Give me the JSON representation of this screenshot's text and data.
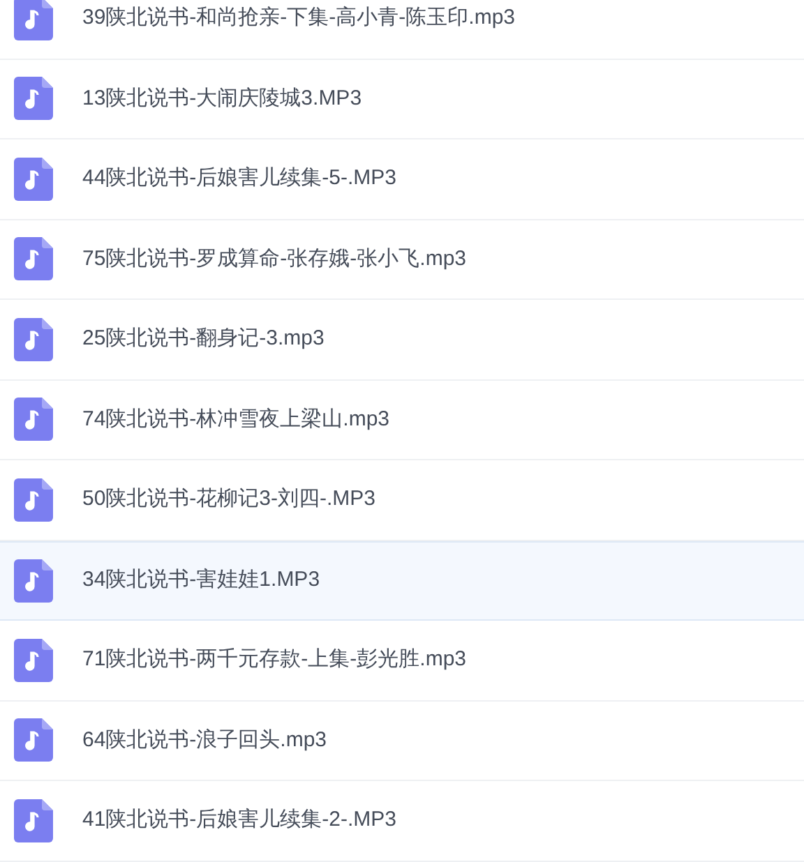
{
  "files": [
    {
      "name": "39陕北说书-和尚抢亲-下集-高小青-陈玉印.mp3",
      "selected": false
    },
    {
      "name": "13陕北说书-大闹庆陵城3.MP3",
      "selected": false
    },
    {
      "name": "44陕北说书-后娘害儿续集-5-.MP3",
      "selected": false
    },
    {
      "name": "75陕北说书-罗成算命-张存娥-张小飞.mp3",
      "selected": false
    },
    {
      "name": "25陕北说书-翻身记-3.mp3",
      "selected": false
    },
    {
      "name": "74陕北说书-林冲雪夜上梁山.mp3",
      "selected": false
    },
    {
      "name": "50陕北说书-花柳记3-刘四-.MP3",
      "selected": false
    },
    {
      "name": "34陕北说书-害娃娃1.MP3",
      "selected": true
    },
    {
      "name": "71陕北说书-两千元存款-上集-彭光胜.mp3",
      "selected": false
    },
    {
      "name": "64陕北说书-浪子回头.mp3",
      "selected": false
    },
    {
      "name": "41陕北说书-后娘害儿续集-2-.MP3",
      "selected": false
    }
  ]
}
